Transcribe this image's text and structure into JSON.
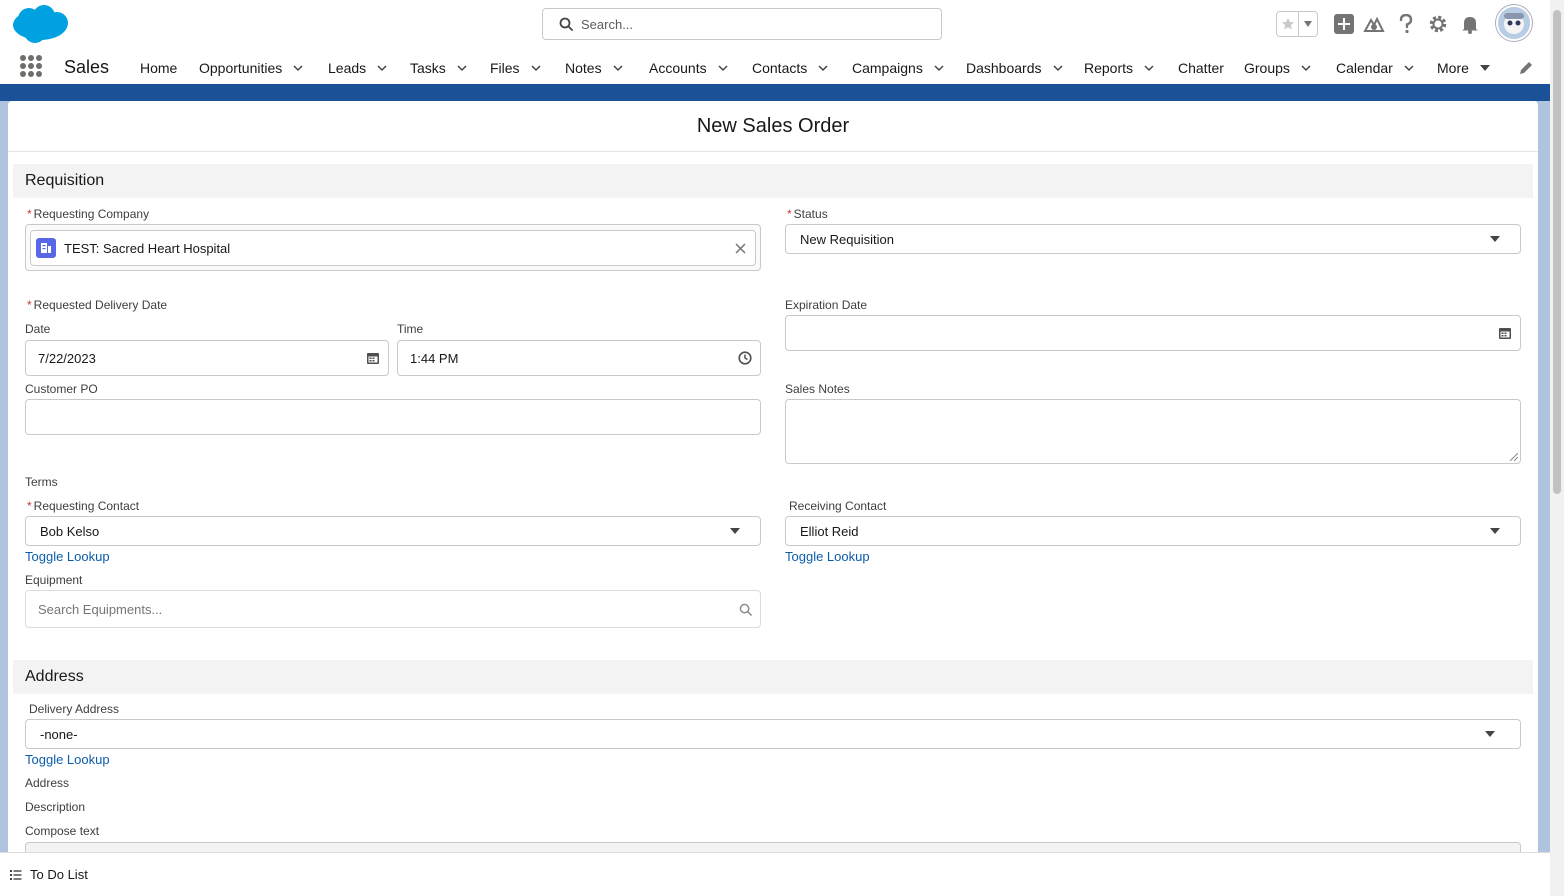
{
  "header": {
    "search_placeholder": "Search...",
    "icons": [
      "salesforce-cloud-logo",
      "favorites-star-icon",
      "favorites-dropdown-icon",
      "global-add-icon",
      "trailhead-icon",
      "help-icon",
      "setup-gear-icon",
      "notifications-bell-icon",
      "user-avatar"
    ]
  },
  "nav": {
    "app_name": "Sales",
    "items": [
      {
        "label": "Home",
        "chevron": false
      },
      {
        "label": "Opportunities",
        "chevron": true
      },
      {
        "label": "Leads",
        "chevron": true
      },
      {
        "label": "Tasks",
        "chevron": true
      },
      {
        "label": "Files",
        "chevron": true
      },
      {
        "label": "Notes",
        "chevron": true
      },
      {
        "label": "Accounts",
        "chevron": true
      },
      {
        "label": "Contacts",
        "chevron": true
      },
      {
        "label": "Campaigns",
        "chevron": true
      },
      {
        "label": "Dashboards",
        "chevron": true
      },
      {
        "label": "Reports",
        "chevron": true
      },
      {
        "label": "Chatter",
        "chevron": false
      },
      {
        "label": "Groups",
        "chevron": true
      },
      {
        "label": "Calendar",
        "chevron": true
      },
      {
        "label": "More",
        "chevron": true
      }
    ]
  },
  "modal": {
    "title": "New Sales Order",
    "requisition": {
      "section_title": "Requisition",
      "requesting_company_label": "Requesting Company",
      "requesting_company_value": "TEST: Sacred Heart Hospital",
      "status_label": "Status",
      "status_value": "New Requisition",
      "requested_delivery_label": "Requested Delivery Date",
      "date_label": "Date",
      "date_value": "7/22/2023",
      "time_label": "Time",
      "time_value": "1:44 PM",
      "expiration_label": "Expiration Date",
      "expiration_value": "",
      "customer_po_label": "Customer PO",
      "customer_po_value": "",
      "sales_notes_label": "Sales Notes",
      "sales_notes_value": "",
      "terms_label": "Terms",
      "requesting_contact_label": "Requesting Contact",
      "requesting_contact_value": "Bob Kelso",
      "receiving_contact_label": "Receiving Contact",
      "receiving_contact_value": "Elliot Reid",
      "toggle_lookup": "Toggle Lookup",
      "equipment_label": "Equipment",
      "equipment_placeholder": "Search Equipments..."
    },
    "address": {
      "section_title": "Address",
      "delivery_address_label": "Delivery Address",
      "delivery_address_value": "-none-",
      "toggle_lookup": "Toggle Lookup",
      "address_label": "Address",
      "description_label": "Description",
      "compose_label": "Compose text"
    }
  },
  "utility_bar": {
    "todo_label": "To Do List"
  },
  "colors": {
    "brand_blue": "#1b5297",
    "link_blue": "#0b5cab",
    "required_red": "#c23934",
    "account_icon": "#5867e8"
  }
}
